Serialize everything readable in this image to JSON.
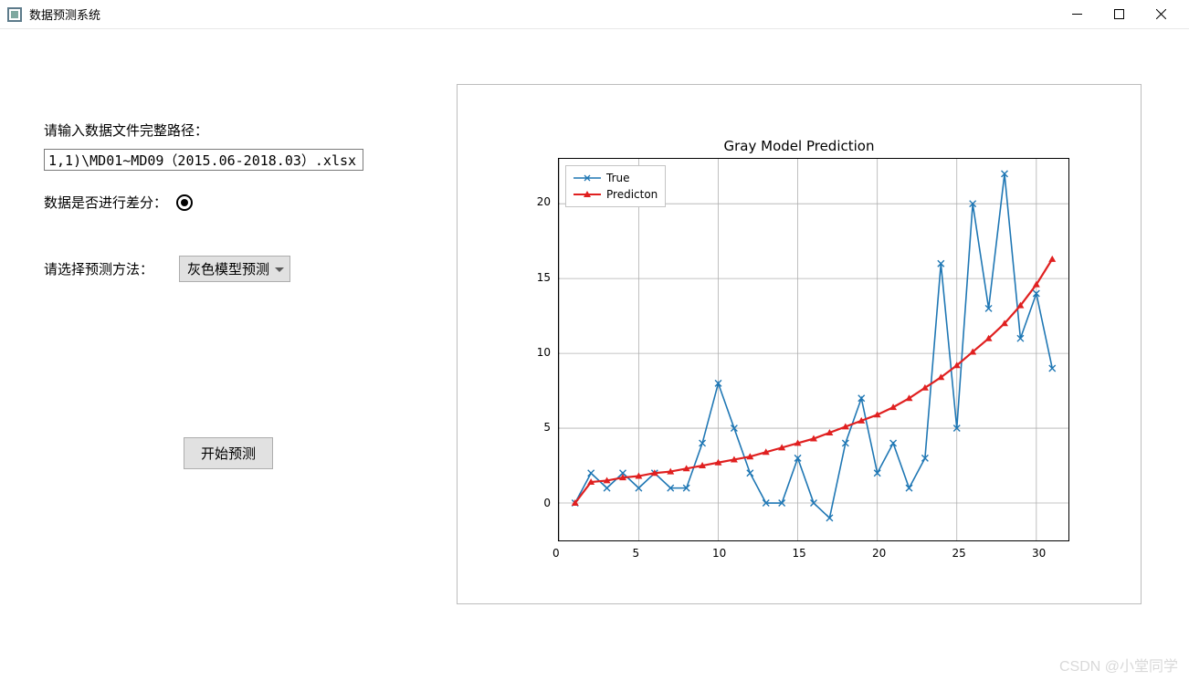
{
  "window": {
    "title": "数据预测系统"
  },
  "form": {
    "path_label": "请输入数据文件完整路径：",
    "path_value": "1,1)\\MD01~MD09（2015.06-2018.03）.xlsx",
    "diff_label": "数据是否进行差分：",
    "method_label": "请选择预测方法：",
    "method_value": "灰色模型预测",
    "predict_button": "开始预测"
  },
  "chart_data": {
    "type": "line",
    "title": "Gray Model Prediction",
    "xlabel": "",
    "ylabel": "",
    "xlim": [
      0,
      32
    ],
    "ylim": [
      -2.5,
      23
    ],
    "xticks": [
      0,
      5,
      10,
      15,
      20,
      25,
      30
    ],
    "yticks": [
      0,
      5,
      10,
      15,
      20
    ],
    "series": [
      {
        "name": "True",
        "color": "#1f77b4",
        "marker": "x",
        "x": [
          1,
          2,
          3,
          4,
          5,
          6,
          7,
          8,
          9,
          10,
          11,
          12,
          13,
          14,
          15,
          16,
          17,
          18,
          19,
          20,
          21,
          22,
          23,
          24,
          25,
          26,
          27,
          28,
          29,
          30,
          31
        ],
        "values": [
          0,
          2,
          1,
          2,
          1,
          2,
          1,
          1,
          4,
          8,
          5,
          2,
          0,
          0,
          3,
          0,
          -1,
          4,
          7,
          2,
          4,
          1,
          3,
          16,
          5,
          20,
          13,
          22,
          11,
          14,
          9
        ]
      },
      {
        "name": "Predicton",
        "color": "#e02020",
        "marker": "^",
        "x": [
          1,
          2,
          3,
          4,
          5,
          6,
          7,
          8,
          9,
          10,
          11,
          12,
          13,
          14,
          15,
          16,
          17,
          18,
          19,
          20,
          21,
          22,
          23,
          24,
          25,
          26,
          27,
          28,
          29,
          30,
          31
        ],
        "values": [
          0.0,
          1.4,
          1.5,
          1.7,
          1.8,
          2.0,
          2.1,
          2.3,
          2.5,
          2.7,
          2.9,
          3.1,
          3.4,
          3.7,
          4.0,
          4.3,
          4.7,
          5.1,
          5.5,
          5.9,
          6.4,
          7.0,
          7.7,
          8.4,
          9.2,
          10.1,
          11.0,
          12.0,
          13.2,
          14.6,
          16.3
        ]
      }
    ],
    "legend_position": "upper-left"
  },
  "watermark": "CSDN @小堂同学"
}
